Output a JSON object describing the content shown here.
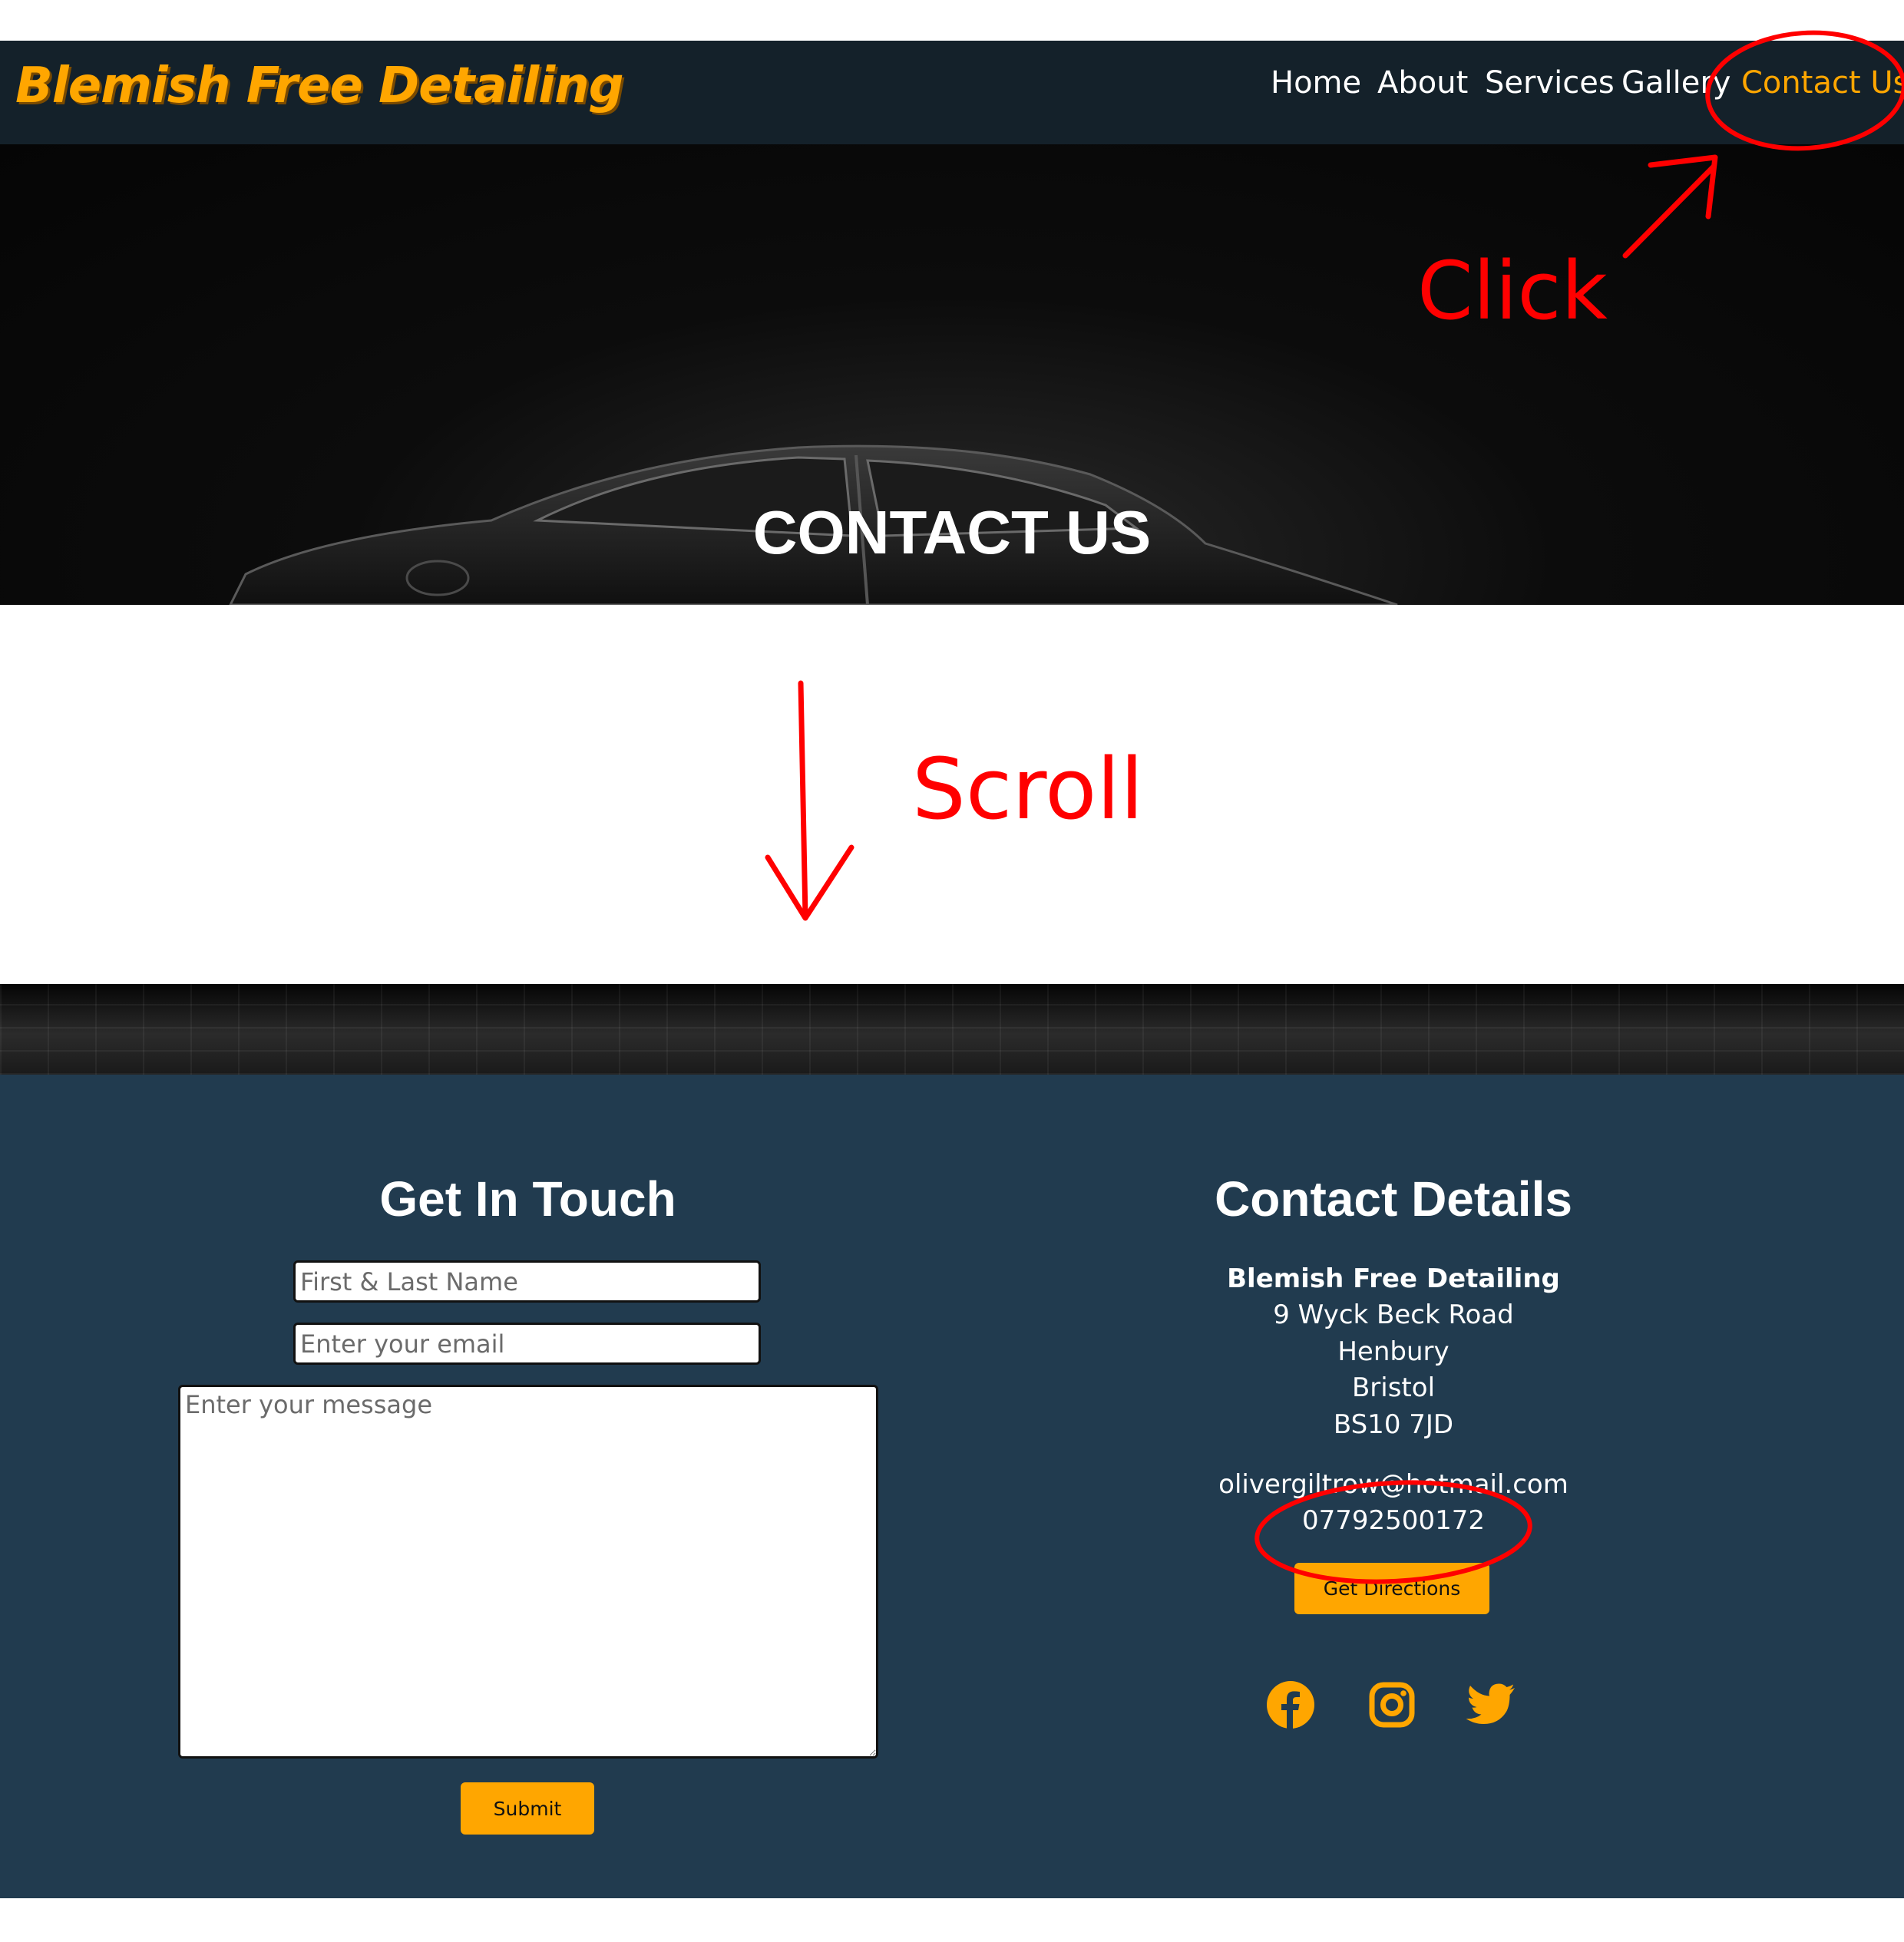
{
  "brand": {
    "name": "Blemish Free Detailing"
  },
  "nav": {
    "items": [
      {
        "label": "Home"
      },
      {
        "label": "About"
      },
      {
        "label": "Services"
      },
      {
        "label": "Gallery"
      },
      {
        "label": "Contact Us",
        "active": true
      }
    ]
  },
  "hero": {
    "title": "CONTACT US"
  },
  "form": {
    "heading": "Get In Touch",
    "name_placeholder": "First & Last Name",
    "email_placeholder": "Enter your email",
    "message_placeholder": "Enter your message",
    "submit_label": "Submit"
  },
  "details": {
    "heading": "Contact Details",
    "business": "Blemish Free Detailing",
    "address_lines": [
      "9 Wyck Beck Road",
      "Henbury",
      "Bristol",
      "BS10 7JD"
    ],
    "email": "olivergiltrow@hotmail.com",
    "phone": "07792500172",
    "directions_label": "Get Directions",
    "social": [
      "facebook-icon",
      "instagram-icon",
      "twitter-icon"
    ]
  },
  "annotations": {
    "click": "Click",
    "scroll": "Scroll"
  },
  "colors": {
    "accent": "#ffa600",
    "navbar": "#14212a",
    "section": "#213b4f",
    "annotation": "#ff0000"
  }
}
